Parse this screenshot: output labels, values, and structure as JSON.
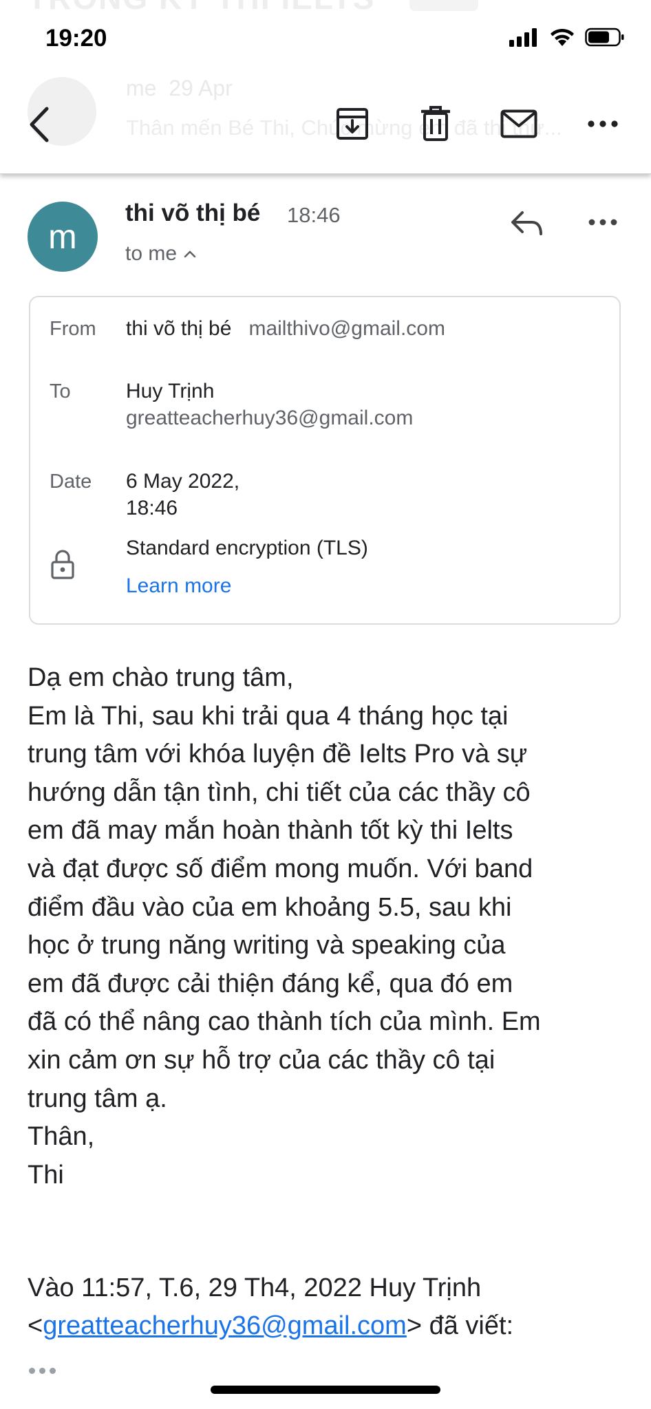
{
  "status_bar": {
    "time": "19:20"
  },
  "background_thread": {
    "subject_fragment": "TRONG KỲ THI IELTS",
    "sender": "me",
    "date": "29 Apr",
    "preview": "Thân mến Bé Thi, Chúc mừng em đã thi thử..."
  },
  "toolbar": {
    "icons": [
      "back-icon",
      "archive-icon",
      "trash-icon",
      "mail-icon",
      "more-icon"
    ]
  },
  "message": {
    "avatar_letter": "m",
    "avatar_color": "#3e8a97",
    "sender_name": "thi võ thị bé",
    "time": "18:46",
    "recipient_summary": "to me"
  },
  "details": {
    "from_label": "From",
    "from_name": "thi võ thị bé",
    "from_email": "mailthivo@gmail.com",
    "to_label": "To",
    "to_name": "Huy Trịnh",
    "to_email": "greatteacherhuy36@gmail.com",
    "date_label": "Date",
    "date_line1": "6 May 2022,",
    "date_line2": "18:46",
    "encryption": "Standard encryption (TLS)",
    "learn_more": "Learn more"
  },
  "body": {
    "lines": [
      "Dạ em chào trung tâm,",
      "Em là Thi, sau khi trải qua 4 tháng học tại",
      "trung tâm với khóa luyện đề Ielts Pro và sự",
      "hướng dẫn tận tình, chi tiết của các thầy cô",
      "em đã may mắn hoàn thành tốt kỳ thi Ielts",
      "và đạt được số điểm mong muốn. Với band",
      "điểm đầu vào của em khoảng 5.5, sau khi",
      "học ở trung năng writing và speaking của",
      "em đã được cải thiện đáng kể, qua đó em",
      "đã có thể nâng cao thành tích của mình. Em",
      "xin cảm ơn sự hỗ trợ của các thầy cô tại",
      "trung tâm ạ.",
      "Thân,",
      "Thi"
    ],
    "quote_header": "Vào 11:57, T.6, 29 Th4, 2022 Huy Trịnh",
    "quote_open": "<",
    "quote_email": "greatteacherhuy36@gmail.com",
    "quote_close": "> đã viết:"
  }
}
